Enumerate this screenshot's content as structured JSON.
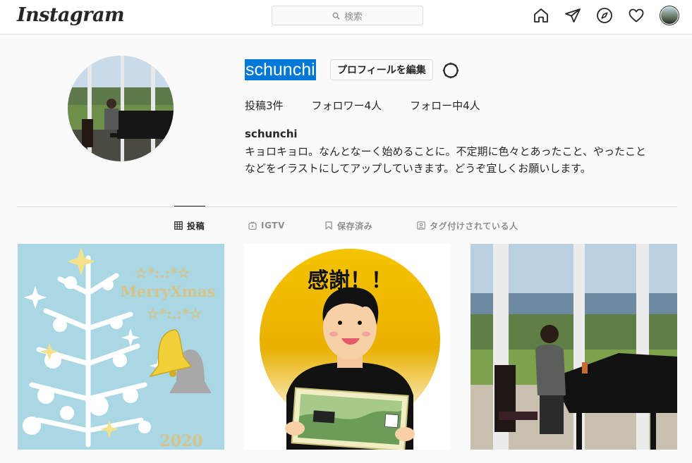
{
  "app": {
    "logo": "Instagram"
  },
  "search": {
    "placeholder": "検索",
    "icon": "search-icon"
  },
  "nav": {
    "icons": [
      "home-icon",
      "direct-message-icon",
      "explore-compass-icon",
      "activity-heart-icon",
      "profile-avatar"
    ]
  },
  "profile": {
    "username": "schunchi",
    "edit_label": "プロフィールを編集",
    "settings_icon": "settings-gear-icon",
    "stats": {
      "posts": "投稿3件",
      "followers": "フォロワー4人",
      "following": "フォロー中4人"
    },
    "full_name": "schunchi",
    "bio_line1": "キョロキョロ。なんとなーく始めることに。不定期に色々とあったこと、やったこと",
    "bio_line2": "などをイラストにしてアップしていきます。どうぞ宜しくお願いします。"
  },
  "tabs": [
    {
      "label": "投稿",
      "icon": "grid-icon",
      "active": true
    },
    {
      "label": "IGTV",
      "icon": "igtv-icon",
      "active": false
    },
    {
      "label": "保存済み",
      "icon": "bookmark-icon",
      "active": false
    },
    {
      "label": "タグ付けされている人",
      "icon": "tagged-person-icon",
      "active": false
    }
  ],
  "posts": [
    {
      "art_text_1": "☆*:.:*☆",
      "art_text_2": "MerryXmas",
      "art_text_3": "☆*:.:*☆",
      "art_text_4": "2020"
    },
    {
      "art_text_1": "感謝！！"
    },
    {}
  ],
  "colors": {
    "accent_blue": "#0078d7",
    "border": "#dbdbdb",
    "muted_text": "#8e8e8e",
    "text": "#262626"
  }
}
